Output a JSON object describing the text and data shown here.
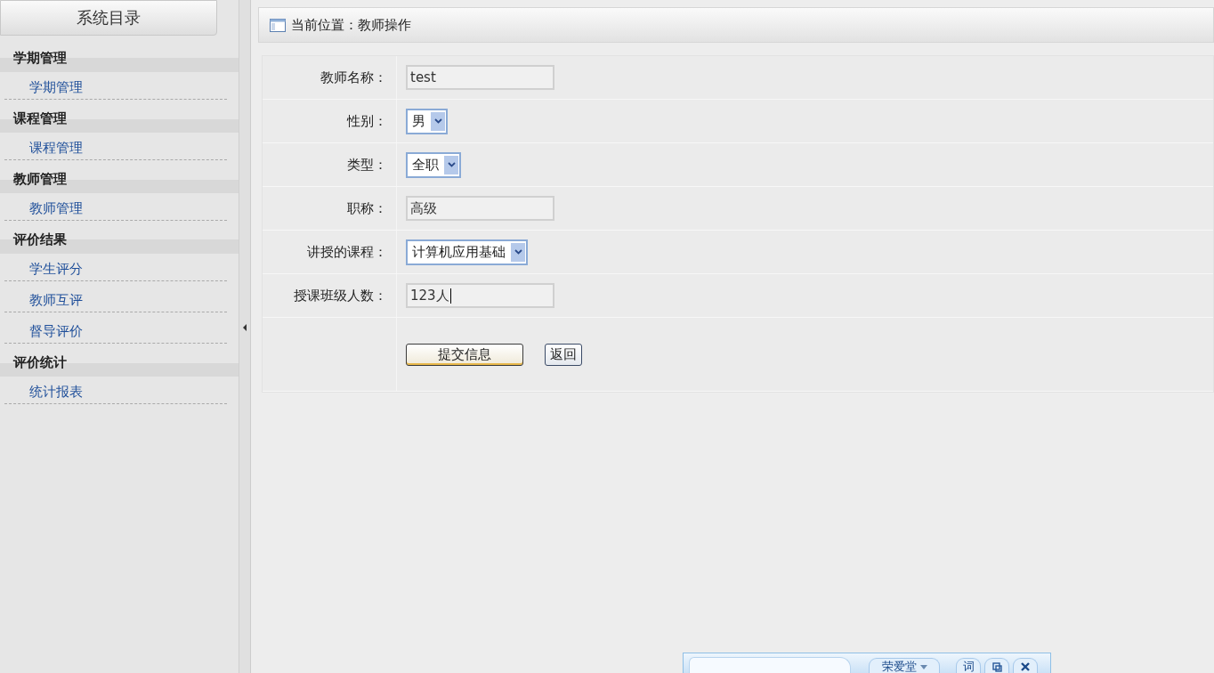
{
  "sidebar": {
    "title": "系统目录",
    "groups": [
      {
        "heading": "学期管理",
        "items": [
          {
            "label": "学期管理"
          }
        ]
      },
      {
        "heading": "课程管理",
        "items": [
          {
            "label": "课程管理"
          }
        ]
      },
      {
        "heading": "教师管理",
        "items": [
          {
            "label": "教师管理"
          }
        ]
      },
      {
        "heading": "评价结果",
        "items": [
          {
            "label": "学生评分"
          },
          {
            "label": "教师互评"
          },
          {
            "label": "督导评价"
          }
        ]
      },
      {
        "heading": "评价统计",
        "items": [
          {
            "label": "统计报表"
          }
        ]
      }
    ]
  },
  "breadcrumb": "当前位置：教师操作",
  "form": {
    "fields": [
      {
        "label": "教师名称：",
        "kind": "text",
        "value": "test"
      },
      {
        "label": "性别：",
        "kind": "select",
        "value": "男"
      },
      {
        "label": "类型：",
        "kind": "select",
        "value": "全职"
      },
      {
        "label": "职称：",
        "kind": "text",
        "value": "高级"
      },
      {
        "label": "讲授的课程：",
        "kind": "select",
        "value": "计算机应用基础"
      },
      {
        "label": "授课班级人数：",
        "kind": "text",
        "value": "123人"
      }
    ],
    "buttons": [
      {
        "label": "提交信息",
        "kind": "primary"
      },
      {
        "label": "返回",
        "kind": "plain"
      }
    ]
  },
  "dictionary_bar": {
    "source": "荣爱堂",
    "button": "词"
  }
}
